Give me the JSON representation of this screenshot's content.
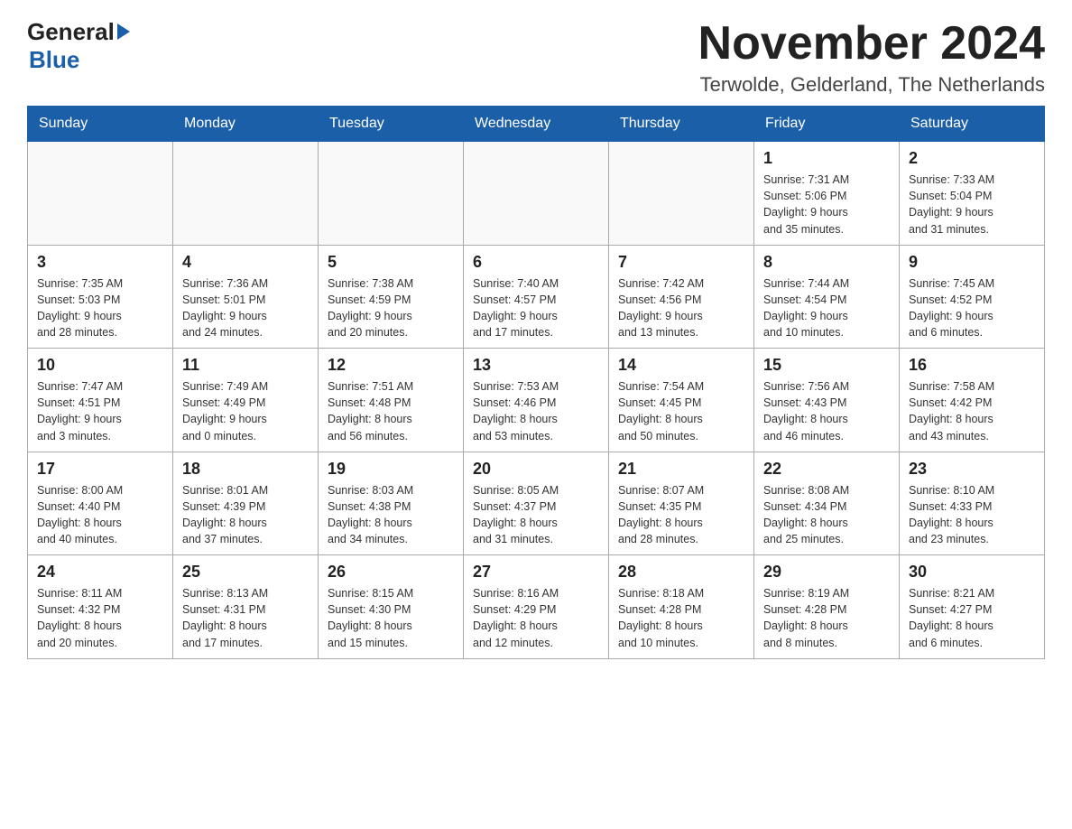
{
  "logo": {
    "general": "General",
    "blue": "Blue"
  },
  "header": {
    "month_year": "November 2024",
    "location": "Terwolde, Gelderland, The Netherlands"
  },
  "weekdays": [
    "Sunday",
    "Monday",
    "Tuesday",
    "Wednesday",
    "Thursday",
    "Friday",
    "Saturday"
  ],
  "weeks": [
    [
      {
        "day": "",
        "info": ""
      },
      {
        "day": "",
        "info": ""
      },
      {
        "day": "",
        "info": ""
      },
      {
        "day": "",
        "info": ""
      },
      {
        "day": "",
        "info": ""
      },
      {
        "day": "1",
        "info": "Sunrise: 7:31 AM\nSunset: 5:06 PM\nDaylight: 9 hours\nand 35 minutes."
      },
      {
        "day": "2",
        "info": "Sunrise: 7:33 AM\nSunset: 5:04 PM\nDaylight: 9 hours\nand 31 minutes."
      }
    ],
    [
      {
        "day": "3",
        "info": "Sunrise: 7:35 AM\nSunset: 5:03 PM\nDaylight: 9 hours\nand 28 minutes."
      },
      {
        "day": "4",
        "info": "Sunrise: 7:36 AM\nSunset: 5:01 PM\nDaylight: 9 hours\nand 24 minutes."
      },
      {
        "day": "5",
        "info": "Sunrise: 7:38 AM\nSunset: 4:59 PM\nDaylight: 9 hours\nand 20 minutes."
      },
      {
        "day": "6",
        "info": "Sunrise: 7:40 AM\nSunset: 4:57 PM\nDaylight: 9 hours\nand 17 minutes."
      },
      {
        "day": "7",
        "info": "Sunrise: 7:42 AM\nSunset: 4:56 PM\nDaylight: 9 hours\nand 13 minutes."
      },
      {
        "day": "8",
        "info": "Sunrise: 7:44 AM\nSunset: 4:54 PM\nDaylight: 9 hours\nand 10 minutes."
      },
      {
        "day": "9",
        "info": "Sunrise: 7:45 AM\nSunset: 4:52 PM\nDaylight: 9 hours\nand 6 minutes."
      }
    ],
    [
      {
        "day": "10",
        "info": "Sunrise: 7:47 AM\nSunset: 4:51 PM\nDaylight: 9 hours\nand 3 minutes."
      },
      {
        "day": "11",
        "info": "Sunrise: 7:49 AM\nSunset: 4:49 PM\nDaylight: 9 hours\nand 0 minutes."
      },
      {
        "day": "12",
        "info": "Sunrise: 7:51 AM\nSunset: 4:48 PM\nDaylight: 8 hours\nand 56 minutes."
      },
      {
        "day": "13",
        "info": "Sunrise: 7:53 AM\nSunset: 4:46 PM\nDaylight: 8 hours\nand 53 minutes."
      },
      {
        "day": "14",
        "info": "Sunrise: 7:54 AM\nSunset: 4:45 PM\nDaylight: 8 hours\nand 50 minutes."
      },
      {
        "day": "15",
        "info": "Sunrise: 7:56 AM\nSunset: 4:43 PM\nDaylight: 8 hours\nand 46 minutes."
      },
      {
        "day": "16",
        "info": "Sunrise: 7:58 AM\nSunset: 4:42 PM\nDaylight: 8 hours\nand 43 minutes."
      }
    ],
    [
      {
        "day": "17",
        "info": "Sunrise: 8:00 AM\nSunset: 4:40 PM\nDaylight: 8 hours\nand 40 minutes."
      },
      {
        "day": "18",
        "info": "Sunrise: 8:01 AM\nSunset: 4:39 PM\nDaylight: 8 hours\nand 37 minutes."
      },
      {
        "day": "19",
        "info": "Sunrise: 8:03 AM\nSunset: 4:38 PM\nDaylight: 8 hours\nand 34 minutes."
      },
      {
        "day": "20",
        "info": "Sunrise: 8:05 AM\nSunset: 4:37 PM\nDaylight: 8 hours\nand 31 minutes."
      },
      {
        "day": "21",
        "info": "Sunrise: 8:07 AM\nSunset: 4:35 PM\nDaylight: 8 hours\nand 28 minutes."
      },
      {
        "day": "22",
        "info": "Sunrise: 8:08 AM\nSunset: 4:34 PM\nDaylight: 8 hours\nand 25 minutes."
      },
      {
        "day": "23",
        "info": "Sunrise: 8:10 AM\nSunset: 4:33 PM\nDaylight: 8 hours\nand 23 minutes."
      }
    ],
    [
      {
        "day": "24",
        "info": "Sunrise: 8:11 AM\nSunset: 4:32 PM\nDaylight: 8 hours\nand 20 minutes."
      },
      {
        "day": "25",
        "info": "Sunrise: 8:13 AM\nSunset: 4:31 PM\nDaylight: 8 hours\nand 17 minutes."
      },
      {
        "day": "26",
        "info": "Sunrise: 8:15 AM\nSunset: 4:30 PM\nDaylight: 8 hours\nand 15 minutes."
      },
      {
        "day": "27",
        "info": "Sunrise: 8:16 AM\nSunset: 4:29 PM\nDaylight: 8 hours\nand 12 minutes."
      },
      {
        "day": "28",
        "info": "Sunrise: 8:18 AM\nSunset: 4:28 PM\nDaylight: 8 hours\nand 10 minutes."
      },
      {
        "day": "29",
        "info": "Sunrise: 8:19 AM\nSunset: 4:28 PM\nDaylight: 8 hours\nand 8 minutes."
      },
      {
        "day": "30",
        "info": "Sunrise: 8:21 AM\nSunset: 4:27 PM\nDaylight: 8 hours\nand 6 minutes."
      }
    ]
  ]
}
